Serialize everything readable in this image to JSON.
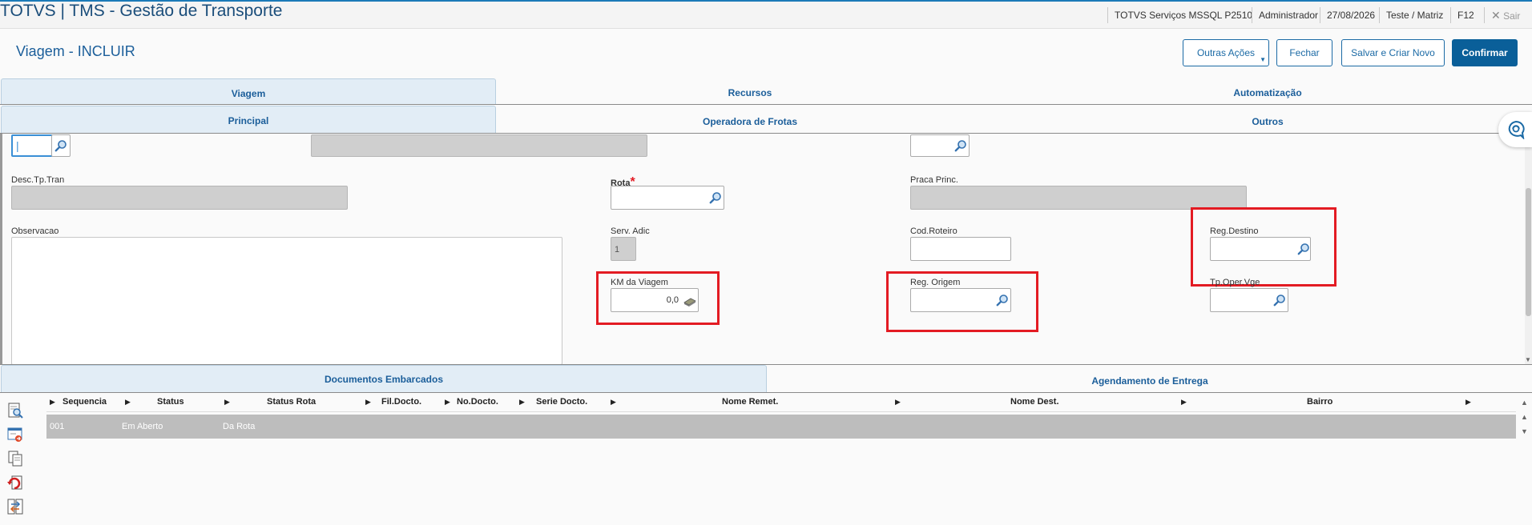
{
  "app": {
    "title": "TOTVS | TMS - Gestão de Transporte"
  },
  "topbar": {
    "server": "TOTVS Serviços MSSQL P2510",
    "user": "Administrador",
    "date": "27/08/2026",
    "branch": "Teste / Matriz",
    "f12": "F12",
    "exit": "Sair"
  },
  "page": {
    "title": "Viagem - INCLUIR"
  },
  "actions": {
    "other": "Outras Ações",
    "close": "Fechar",
    "save_new": "Salvar e Criar Novo",
    "confirm": "Confirmar"
  },
  "tabs_main": [
    "Viagem",
    "Recursos",
    "Automatização"
  ],
  "tabs_sub": [
    "Principal",
    "Operadora de Frotas",
    "Outros"
  ],
  "form": {
    "top_field_value": "|",
    "desc_tp_tran": {
      "label": "Desc.Tp.Tran",
      "value": ""
    },
    "rota": {
      "label": "Rota",
      "required": "*",
      "value": ""
    },
    "praca_princ": {
      "label": "Praca Princ.",
      "value": ""
    },
    "observacao": {
      "label": "Observacao",
      "value": ""
    },
    "serv_adic": {
      "label": "Serv. Adic",
      "value": "1"
    },
    "cod_roteiro": {
      "label": "Cod.Roteiro",
      "value": ""
    },
    "reg_destino": {
      "label": "Reg.Destino",
      "value": ""
    },
    "km_viagem": {
      "label": "KM da Viagem",
      "value": "0,0"
    },
    "reg_origem": {
      "label": "Reg. Origem",
      "value": ""
    },
    "tp_oper_vge": {
      "label": "Tp.Oper.Vge",
      "value": ""
    }
  },
  "bottom_tabs": [
    "Documentos Embarcados",
    "Agendamento de Entrega"
  ],
  "grid": {
    "columns": [
      "Sequencia",
      "Status",
      "Status Rota",
      "Fil.Docto.",
      "No.Docto.",
      "Serie Docto.",
      "Nome Remet.",
      "Nome Dest.",
      "Bairro"
    ],
    "rows": [
      [
        "001",
        "Em Aberto",
        "Da Rota",
        "",
        "",
        "",
        "",
        "",
        ""
      ]
    ]
  },
  "colors": {
    "accent": "#0a5f99",
    "highlight": "#e31b23",
    "readonly": "#cfcfcf"
  }
}
